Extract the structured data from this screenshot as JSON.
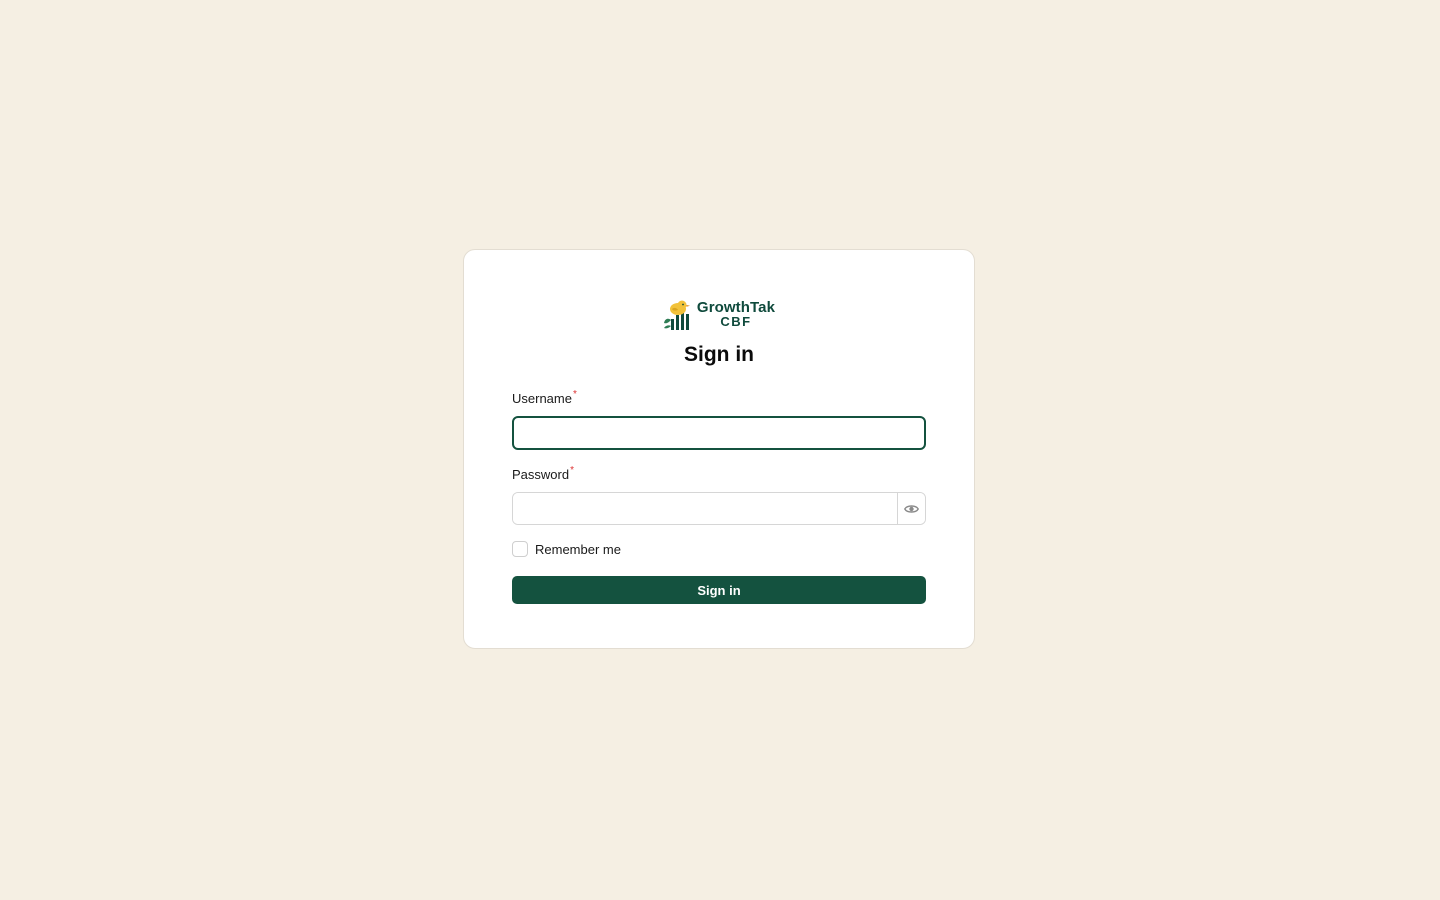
{
  "brand": {
    "line1": "GrowthTak",
    "line2": "CBF",
    "color": "#0f4a3c",
    "accent": "#f2c23a"
  },
  "form": {
    "title": "Sign in",
    "username": {
      "label": "Username",
      "required_mark": "*",
      "value": "",
      "placeholder": ""
    },
    "password": {
      "label": "Password",
      "required_mark": "*",
      "value": "",
      "placeholder": "",
      "toggle_icon": "eye-icon"
    },
    "remember": {
      "label": "Remember me",
      "checked": false
    },
    "submit_label": "Sign in"
  },
  "colors": {
    "background": "#f5efe3",
    "primary": "#14523f",
    "required": "#dd3333"
  }
}
